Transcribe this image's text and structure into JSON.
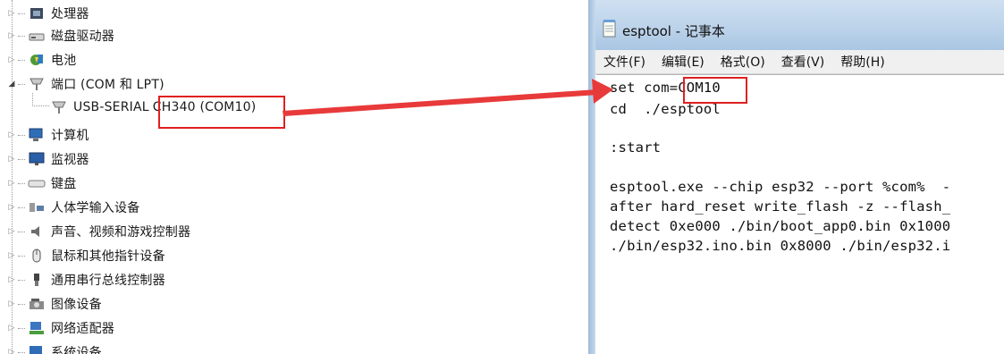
{
  "device_manager": {
    "items": [
      {
        "label": "处理器",
        "icon": "processor-icon"
      },
      {
        "label": "磁盘驱动器",
        "icon": "disk-drive-icon"
      },
      {
        "label": "电池",
        "icon": "battery-icon"
      },
      {
        "label": "端口 (COM 和 LPT)",
        "icon": "port-icon"
      },
      {
        "label_prefix": "USB-SERIAL ",
        "label_highlight": "CH340 (COM10)",
        "icon": "port-icon"
      },
      {
        "label": "计算机",
        "icon": "computer-icon"
      },
      {
        "label": "监视器",
        "icon": "monitor-icon"
      },
      {
        "label": "键盘",
        "icon": "keyboard-icon"
      },
      {
        "label": "人体学输入设备",
        "icon": "hid-icon"
      },
      {
        "label": "声音、视频和游戏控制器",
        "icon": "speaker-icon"
      },
      {
        "label": "鼠标和其他指针设备",
        "icon": "mouse-icon"
      },
      {
        "label": "通用串行总线控制器",
        "icon": "usb-icon"
      },
      {
        "label": "图像设备",
        "icon": "camera-icon"
      },
      {
        "label": "网络适配器",
        "icon": "network-adapter-icon"
      },
      {
        "label": "系统设备",
        "icon": "system-device-icon"
      }
    ]
  },
  "notepad": {
    "title": "esptool - 记事本",
    "menu": [
      "文件(F)",
      "编辑(E)",
      "格式(O)",
      "查看(V)",
      "帮助(H)"
    ],
    "lines": {
      "l1_prefix": "set com=",
      "l1_highlight": "COM10",
      "l2": "cd  ./esptool",
      "l3": "",
      "l4": ":start",
      "l5": "",
      "l6": "esptool.exe --chip esp32 --port %com%  -",
      "l7": "after hard_reset write_flash -z --flash_",
      "l8": "detect 0xe000 ./bin/boot_app0.bin 0x1000",
      "l9": "./bin/esp32.ino.bin 0x8000 ./bin/esp32.i"
    }
  },
  "colors": {
    "highlight": "#e02020",
    "arrow": "#e83a3a"
  }
}
